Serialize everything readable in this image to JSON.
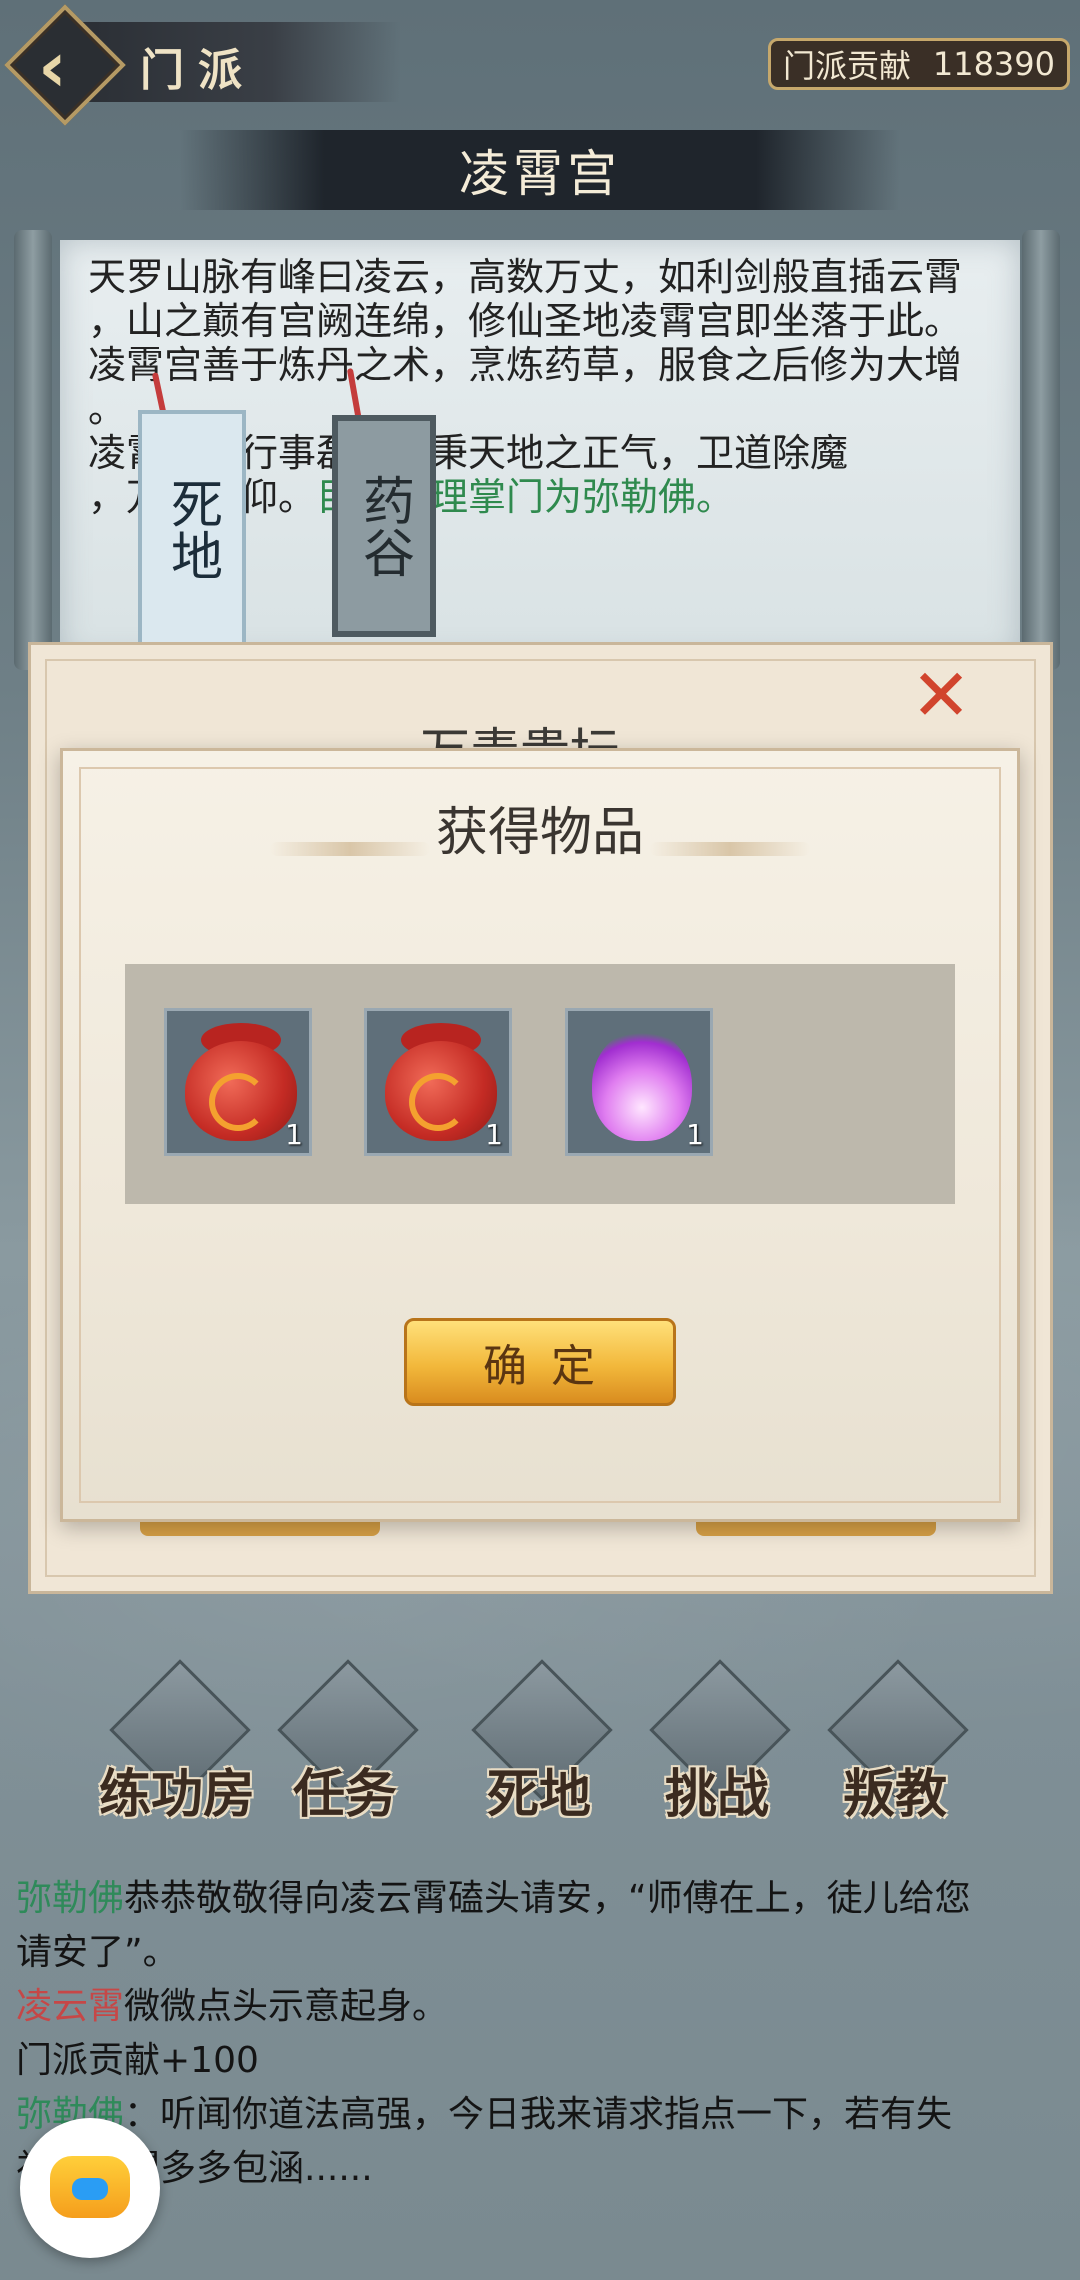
{
  "header": {
    "title": "门派",
    "contribution_label": "门派贡献",
    "contribution_value": "118390"
  },
  "banner_title": "凌霄宫",
  "scroll": {
    "line1": "天罗山脉有峰曰凌云，高数万丈，如利剑般直插云霄",
    "line2": "，山之巅有宫阙连绵，修仙圣地凌霄宫即坐落于此。",
    "line3": "凌霄宫善于炼丹之术，烹炼药草，服食之后修为大增",
    "line4": "。",
    "line5": "凌霄宫人行事磊落，秉天地之正气，卫道除魔",
    "line6": "，万人敬仰。",
    "line6_green": "目前代理掌门为弥勒佛。"
  },
  "tags": {
    "left": "死地",
    "right": "药谷"
  },
  "outer_dialog": {
    "title": "万毒贵坛"
  },
  "reward_dialog": {
    "title": "获得物品",
    "items": [
      {
        "icon": "red-pouch-icon",
        "count": "1"
      },
      {
        "icon": "red-pouch-icon",
        "count": "1"
      },
      {
        "icon": "purple-flame-icon",
        "count": "1"
      }
    ],
    "confirm_label": "确定"
  },
  "menu": [
    {
      "label": "练功房"
    },
    {
      "label": "任务"
    },
    {
      "label": "死地"
    },
    {
      "label": "挑战"
    },
    {
      "label": "叛教"
    }
  ],
  "log": {
    "l1_name": "弥勒佛",
    "l1_text": "恭恭敬敬得向凌云霄磕头请安，“师傅在上，徒儿给您",
    "l1b_text": "请安了”。",
    "l2_name": "凌云霄",
    "l2_text": "微微点头示意起身。",
    "l3_text": "门派贡献+100",
    "l4_name": "弥勒佛",
    "l4_text": "：听闻你道法高强，今日我来请求指点一下，若有失",
    "l4b_text": "礼，还望多多包涵......"
  },
  "colors": {
    "green": "#2f8a5a",
    "red": "#c64747",
    "gold": "#f2b83b",
    "close": "#d1442d"
  }
}
